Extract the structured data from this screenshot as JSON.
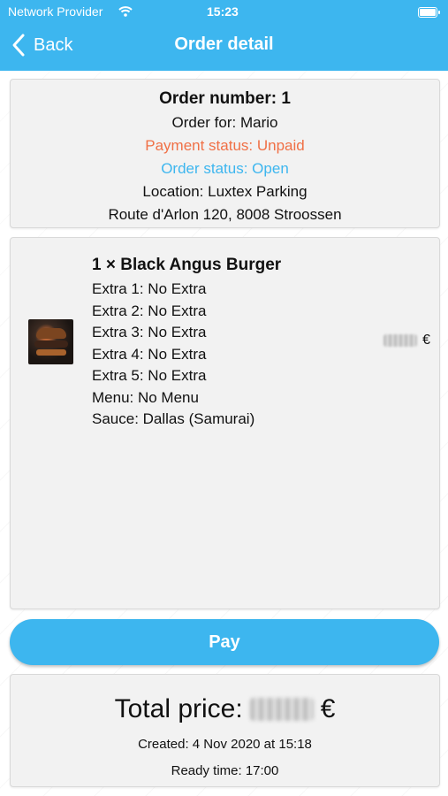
{
  "status_bar": {
    "carrier": "Network Provider",
    "time": "15:23",
    "wifi_icon": "wifi-icon",
    "battery_icon": "battery-icon"
  },
  "nav": {
    "back_label": "Back",
    "title": "Order detail"
  },
  "order": {
    "number_label": "Order number: 1",
    "for_label": "Order for: Mario",
    "payment_status": "Payment status: Unpaid",
    "order_status": "Order status: Open",
    "location": "Location: Luxtex Parking",
    "address": "Route d'Arlon 120, 8008 Stroossen"
  },
  "item": {
    "title": "1 × Black Angus Burger",
    "extras": [
      "Extra 1: No Extra",
      "Extra 2: No Extra",
      "Extra 3: No Extra",
      "Extra 4: No Extra",
      "Extra 5: No Extra",
      "Menu: No Menu",
      "Sauce: Dallas (Samurai)"
    ],
    "currency": "€"
  },
  "pay_button": "Pay",
  "summary": {
    "total_label": "Total price:",
    "currency": "€",
    "created": "Created: 4 Nov 2020 at 15:18",
    "ready": "Ready time: 17:00"
  },
  "colors": {
    "accent": "#3db6ef",
    "unpaid": "#f07046"
  }
}
